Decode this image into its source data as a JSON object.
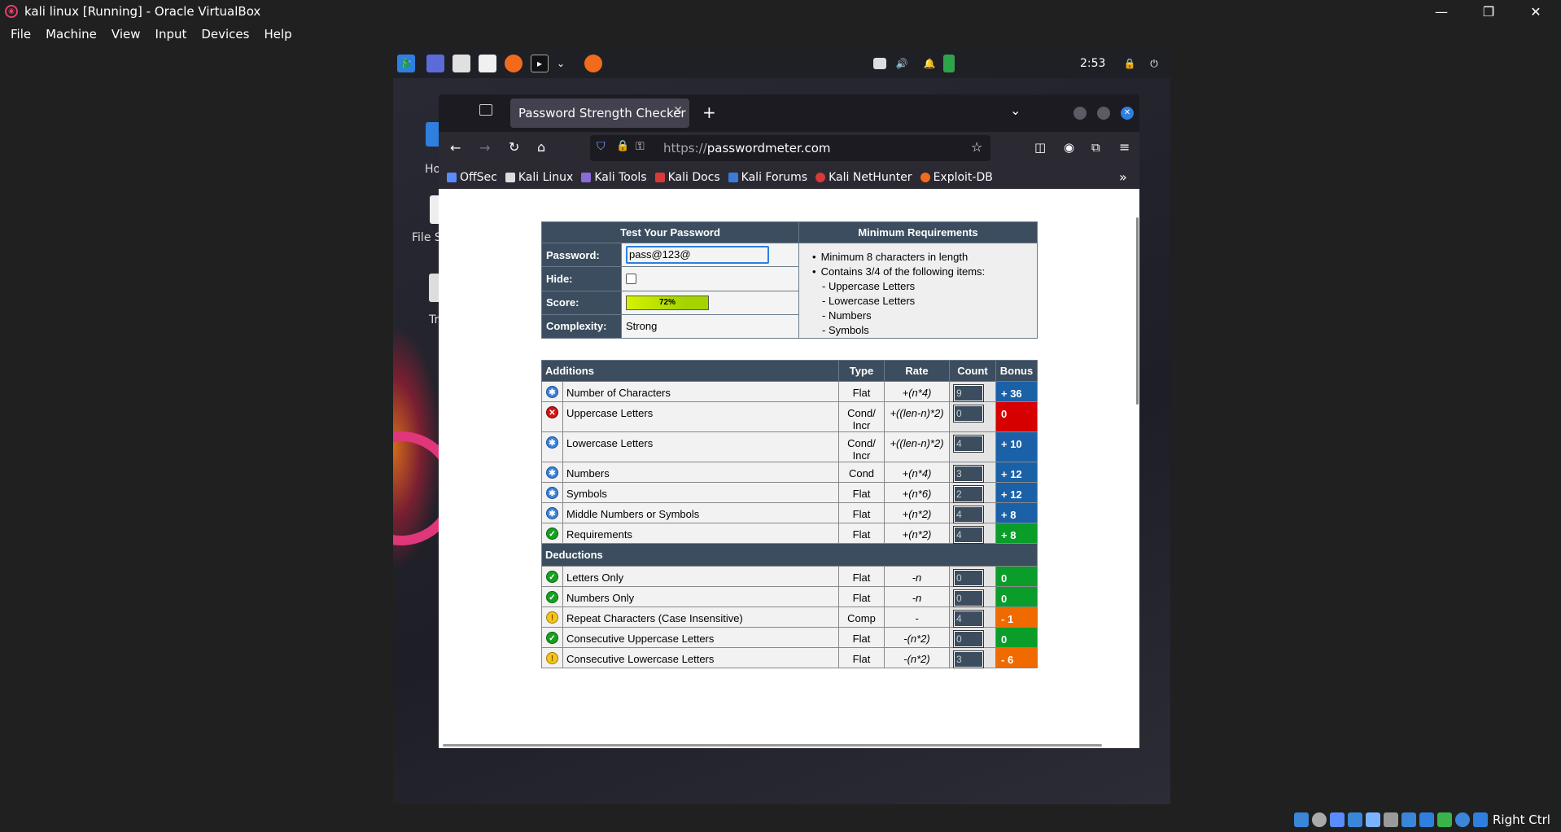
{
  "window": {
    "title": "kali linux [Running] - Oracle VirtualBox"
  },
  "menubar": [
    "File",
    "Machine",
    "View",
    "Input",
    "Devices",
    "Help"
  ],
  "kali_panel": {
    "clock": "2:53"
  },
  "desktop_icons": [
    "Ho",
    "File S",
    "Tr"
  ],
  "browser": {
    "tab_title": "Password Strength Checker",
    "url_scheme": "https://",
    "url_host": "passwordmeter.com",
    "bookmarks": [
      "OffSec",
      "Kali Linux",
      "Kali Tools",
      "Kali Docs",
      "Kali Forums",
      "Kali NetHunter",
      "Exploit-DB"
    ]
  },
  "test": {
    "header_left": "Test Your Password",
    "header_right": "Minimum Requirements",
    "password_label": "Password:",
    "password_value": "pass@123@",
    "hide_label": "Hide:",
    "score_label": "Score:",
    "score_value": "72%",
    "score_fraction": 0.72,
    "complexity_label": "Complexity:",
    "complexity_value": "Strong",
    "requirements": [
      "Minimum 8 characters in length",
      "Contains 3/4 of the following items:",
      "- Uppercase Letters",
      "- Lowercase Letters",
      "- Numbers",
      "- Symbols"
    ]
  },
  "table": {
    "headers": {
      "additions": "Additions",
      "type": "Type",
      "rate": "Rate",
      "count": "Count",
      "bonus": "Bonus",
      "deductions": "Deductions"
    },
    "additions": [
      {
        "icon": "plus",
        "name": "Number of Characters",
        "type": "Flat",
        "rate": "+(n*4)",
        "count": "9",
        "bonus": "+ 36",
        "color": "blue"
      },
      {
        "icon": "fail",
        "name": "Uppercase Letters",
        "type": "Cond/ Incr",
        "rate": "+((len-n)*2)",
        "count": "0",
        "bonus": "0",
        "color": "red"
      },
      {
        "icon": "plus",
        "name": "Lowercase Letters",
        "type": "Cond/ Incr",
        "rate": "+((len-n)*2)",
        "count": "4",
        "bonus": "+ 10",
        "color": "blue"
      },
      {
        "icon": "plus",
        "name": "Numbers",
        "type": "Cond",
        "rate": "+(n*4)",
        "count": "3",
        "bonus": "+ 12",
        "color": "blue"
      },
      {
        "icon": "plus",
        "name": "Symbols",
        "type": "Flat",
        "rate": "+(n*6)",
        "count": "2",
        "bonus": "+ 12",
        "color": "blue"
      },
      {
        "icon": "plus",
        "name": "Middle Numbers or Symbols",
        "type": "Flat",
        "rate": "+(n*2)",
        "count": "4",
        "bonus": "+ 8",
        "color": "blue"
      },
      {
        "icon": "pass",
        "name": "Requirements",
        "type": "Flat",
        "rate": "+(n*2)",
        "count": "4",
        "bonus": "+ 8",
        "color": "green"
      }
    ],
    "deductions": [
      {
        "icon": "pass",
        "name": "Letters Only",
        "type": "Flat",
        "rate": "-n",
        "count": "0",
        "bonus": "0",
        "color": "green"
      },
      {
        "icon": "pass",
        "name": "Numbers Only",
        "type": "Flat",
        "rate": "-n",
        "count": "0",
        "bonus": "0",
        "color": "green"
      },
      {
        "icon": "warn",
        "name": "Repeat Characters (Case Insensitive)",
        "type": "Comp",
        "rate": "-",
        "count": "4",
        "bonus": "- 1",
        "color": "orange"
      },
      {
        "icon": "pass",
        "name": "Consecutive Uppercase Letters",
        "type": "Flat",
        "rate": "-(n*2)",
        "count": "0",
        "bonus": "0",
        "color": "green"
      },
      {
        "icon": "warn",
        "name": "Consecutive Lowercase Letters",
        "type": "Flat",
        "rate": "-(n*2)",
        "count": "3",
        "bonus": "- 6",
        "color": "orange"
      }
    ]
  },
  "statusbar": {
    "hostkey": "Right Ctrl"
  }
}
